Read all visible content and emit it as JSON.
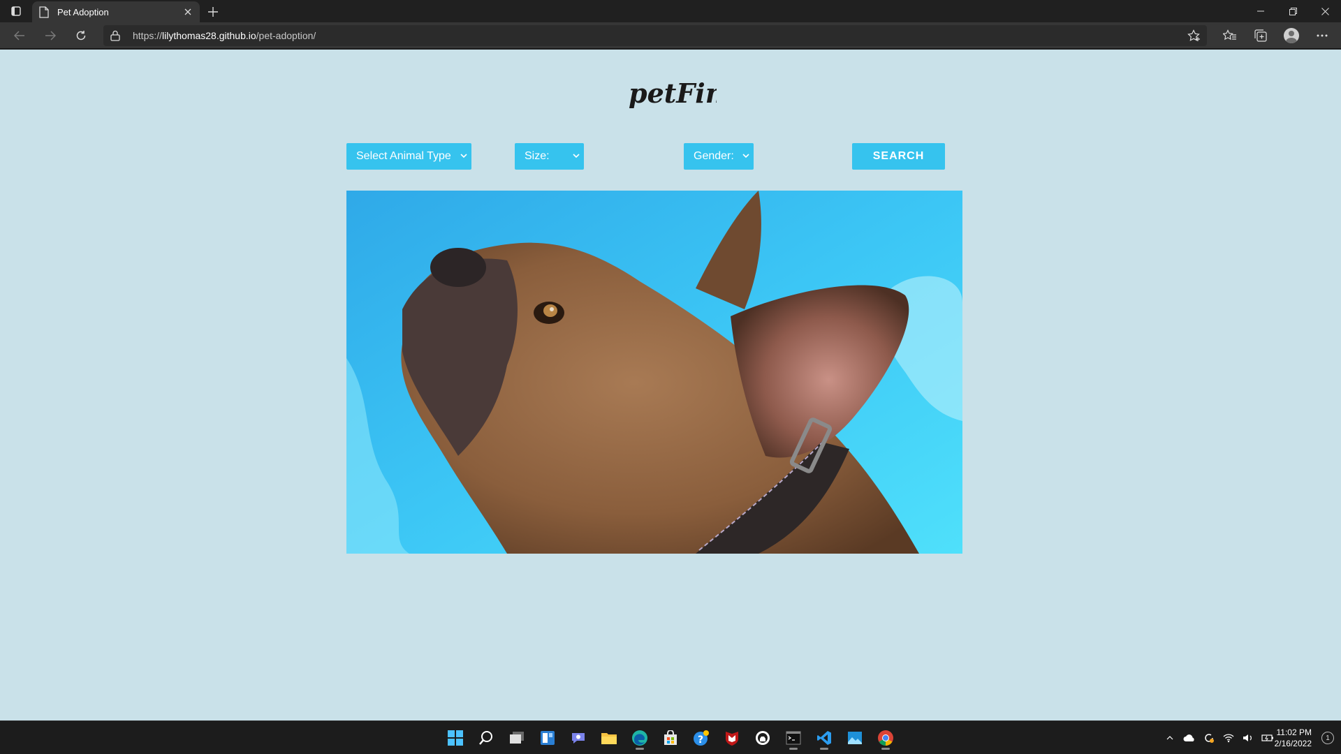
{
  "browser": {
    "tab_title": "Pet Adoption",
    "url_scheme": "https://",
    "url_host": "lilythomas28.github.io",
    "url_path": "/pet-adoption/"
  },
  "page": {
    "logo_text": "petFinder",
    "filters": {
      "animal_type": "Select Animal Type",
      "size": "Size:",
      "gender": "Gender:"
    },
    "search_label": "SEARCH",
    "hero_alt": "French bulldog looking up against a blue sky"
  },
  "taskbar": {
    "time": "11:02 PM",
    "date": "2/16/2022",
    "notification_count": "1",
    "apps": [
      "start-icon",
      "search-icon",
      "task-view-icon",
      "widgets-icon",
      "teams-chat-icon",
      "file-explorer-icon",
      "edge-icon",
      "store-icon",
      "help-icon",
      "mcafee-icon",
      "github-icon",
      "terminal-icon",
      "vscode-icon",
      "photos-icon",
      "chrome-icon"
    ]
  },
  "colors": {
    "page_bg": "#c9e1e9",
    "accent": "#36c3ee"
  }
}
